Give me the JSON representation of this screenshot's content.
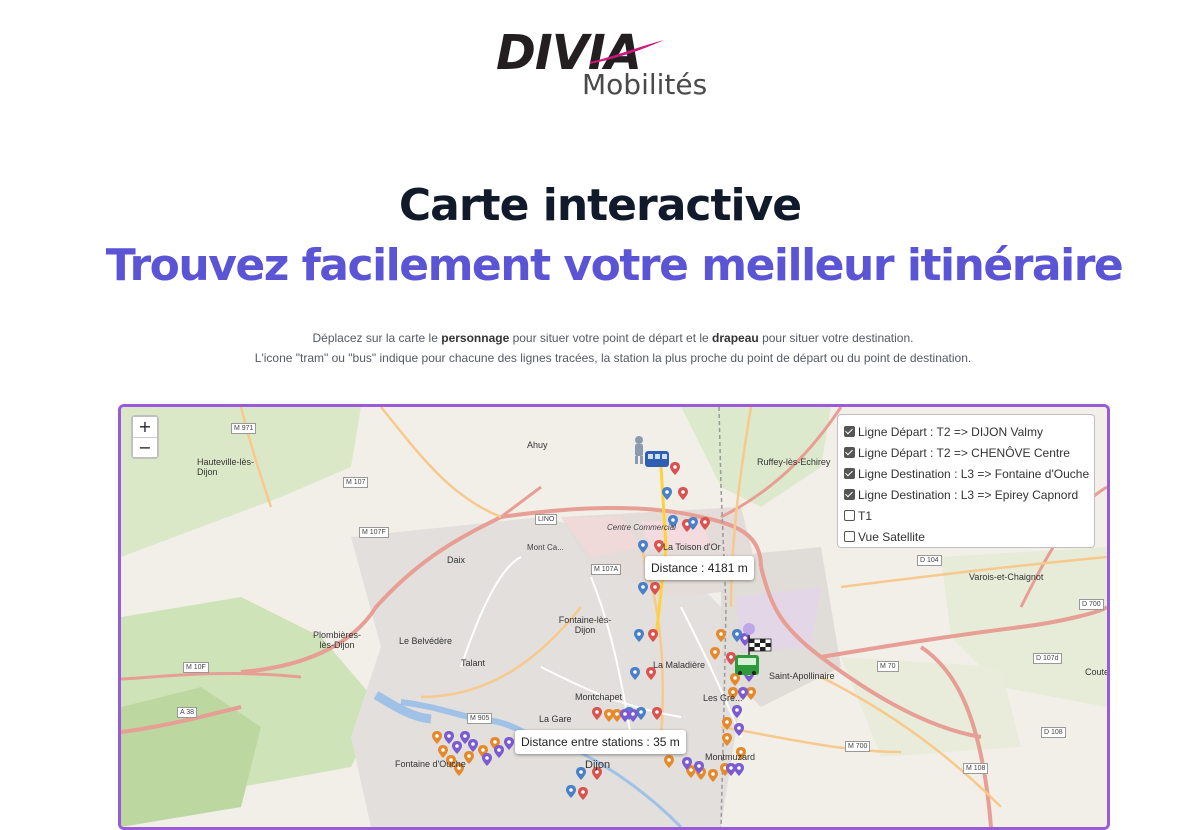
{
  "logo": {
    "brand": "DIVIA",
    "sub": "Mobilités",
    "accent_color": "#d0167a"
  },
  "header": {
    "title": "Carte interactive",
    "subtitle": "Trouvez facilement votre meilleur itinéraire",
    "title_color": "#111a2b",
    "subtitle_color": "#5b55d6"
  },
  "description": {
    "line1_a": "Déplacez sur la carte le ",
    "line1_b": "personnage",
    "line1_c": " pour situer votre point de départ et le ",
    "line1_d": "drapeau",
    "line1_e": " pour situer votre destination.",
    "line2": "L'icone \"tram\" ou \"bus\" indique pour chacune des lignes tracées, la station la plus proche du point de départ ou du point de destination."
  },
  "map": {
    "border_color": "#9a5bd9",
    "zoom_in": "+",
    "zoom_out": "−",
    "layers": [
      {
        "label": "Ligne Départ : T2 => DIJON Valmy",
        "checked": true
      },
      {
        "label": "Ligne Départ : T2 => CHENÔVE Centre",
        "checked": true
      },
      {
        "label": "Ligne Destination : L3 => Fontaine d'Ouche",
        "checked": true
      },
      {
        "label": "Ligne Destination : L3 => Epirey Capnord",
        "checked": true
      },
      {
        "label": "T1",
        "checked": false
      },
      {
        "label": "Vue Satellite",
        "checked": false
      }
    ],
    "tooltip_distance": "Distance : 4181 m",
    "tooltip_stations": "Distance entre stations : 35 m",
    "places": {
      "ahuy": "Ahuy",
      "hauteville": "Hauteville-lès-Dijon",
      "ruffey": "Ruffey-lès-Echirey",
      "daix": "Daix",
      "montchapet_top": "Mont Ca...",
      "toison": "La Toison d'Or",
      "centre_commercial": "Centre Commercial",
      "varois": "Varois-et-Chaignot",
      "belvedere": "Le Belvédère",
      "fontaine": "Fontaine-lès-Dijon",
      "plombieres": "Plombières-lès-Dijon",
      "talant": "Talant",
      "maladiere": "La Maladière",
      "saint_apollinaire": "Saint-Apollinaire",
      "montchapet": "Montchapet",
      "la_gare": "La Gare",
      "dijon": "Dijon",
      "fontaine_ouche": "Fontaine d'Ouche",
      "montmuzard": "Montmuzard",
      "les_grezilles": "Les Gré...",
      "coute": "Coute"
    },
    "roads": [
      "M 971",
      "M 107",
      "M 107F",
      "LINO",
      "M 107A",
      "M 10F",
      "A 38",
      "M 905",
      "D 104",
      "D 700",
      "M 70",
      "D 107d",
      "M 700",
      "D 108",
      "M 108"
    ]
  }
}
